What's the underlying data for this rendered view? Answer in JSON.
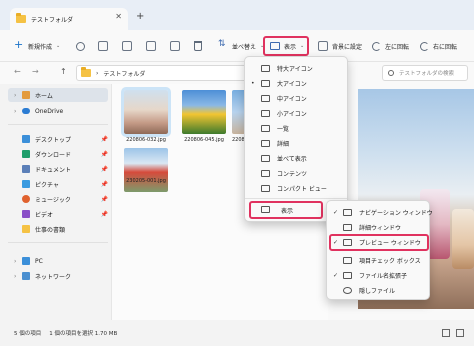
{
  "tab": {
    "title": "テストフォルダ",
    "close": "✕",
    "new": "+"
  },
  "toolbar": {
    "new_label": "新規作成",
    "new_chevron": "⌄",
    "sort_label": "並べ替え",
    "view_label": "表示",
    "wallpaper_label": "背景に設定",
    "rotate_left_label": "左に回転",
    "rotate_right_label": "右に回転",
    "more": "···"
  },
  "address": {
    "back": "←",
    "forward": "→",
    "up": "↑",
    "chevron": "›",
    "path": "テストフォルダ",
    "search_placeholder": "テストフォルダの検索"
  },
  "sidebar": {
    "home": "ホーム",
    "onedrive": "OneDrive",
    "items": [
      "デスクトップ",
      "ダウンロード",
      "ドキュメント",
      "ピクチャ",
      "ミュージック",
      "ビデオ",
      "仕事の書類"
    ],
    "pc": "PC",
    "network": "ネットワーク",
    "pin": "📌",
    "expand": "›"
  },
  "files": [
    {
      "name": "220806-032.jpg"
    },
    {
      "name": "220806-045.jpg"
    },
    {
      "name": "2208"
    },
    {
      "name": "230205-001.jpg"
    }
  ],
  "status": {
    "count": "5 個の項目",
    "selected": "1 個の項目を選択 1.70 MB"
  },
  "view_menu": {
    "items": [
      "特大アイコン",
      "大アイコン",
      "中アイコン",
      "小アイコン",
      "一覧",
      "詳細",
      "並べて表示",
      "コンテンツ",
      "コンパクト ビュー"
    ],
    "checked_index": 1,
    "bullet": "•",
    "submenu_label": "表示",
    "submenu_arrow": "›"
  },
  "show_menu": {
    "items": [
      "ナビゲーション ウィンドウ",
      "詳細ウィンドウ",
      "プレビュー ウィンドウ",
      "項目チェック ボックス",
      "ファイル名拡張子",
      "隠しファイル"
    ],
    "checks": [
      "✓",
      "",
      "✓",
      "",
      "✓",
      ""
    ]
  },
  "colors": {
    "highlight": "#e0325f",
    "accent": "#1a73c9",
    "selection": "#cce4f7"
  }
}
